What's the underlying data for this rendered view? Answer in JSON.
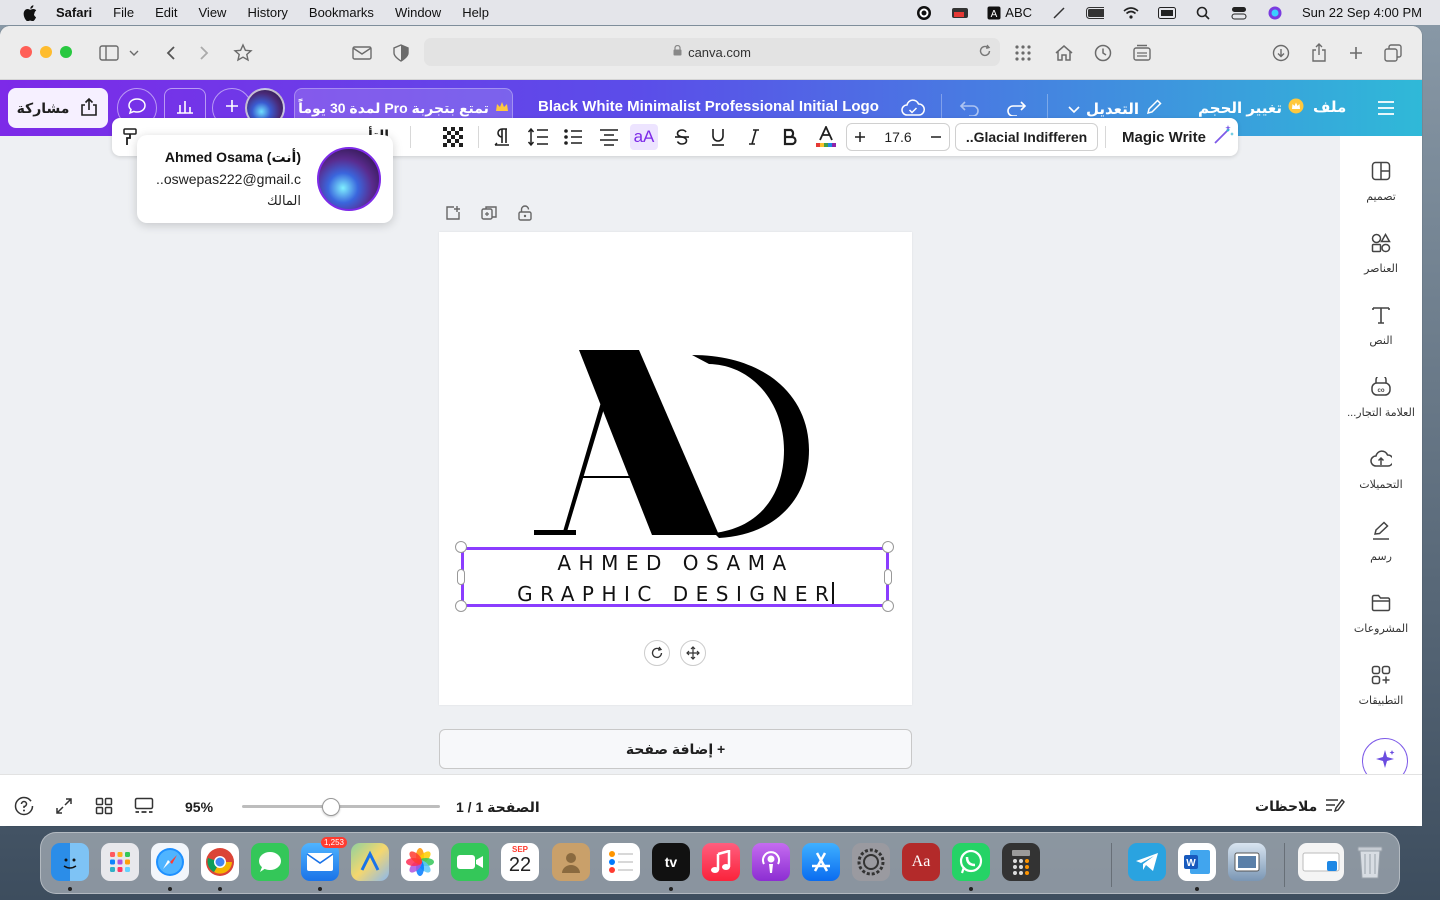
{
  "menubar": {
    "app": "Safari",
    "items": [
      "File",
      "Edit",
      "View",
      "History",
      "Bookmarks",
      "Window",
      "Help"
    ],
    "input_label": "ABC",
    "datetime": "Sun 22 Sep  4:00 PM"
  },
  "browser": {
    "url": "canva.com"
  },
  "canva_header": {
    "share_label": "مشاركة",
    "pro_trial": "تمتع بتجربة Pro لمدة 30 يوماً",
    "doc_title": "Black White Minimalist Professional Initial Logo",
    "edit_label": "التعديل",
    "resize_label": "تغيير الحجم",
    "file_label": "ملف"
  },
  "profile_popup": {
    "name": "Ahmed Osama (أنت)",
    "email": "..oswepas222@gmail.c",
    "role": "المالك"
  },
  "text_toolbar": {
    "partial_label": "التأ",
    "font_name": "..Glacial Indifferen",
    "font_size": "17.6",
    "case_label": "aA",
    "magic_write": "Magic Write"
  },
  "right_panel": {
    "items": [
      {
        "label": "تصميم",
        "icon": "design-icon"
      },
      {
        "label": "العناصر",
        "icon": "elements-icon"
      },
      {
        "label": "النص",
        "icon": "text-icon"
      },
      {
        "label": "العلامة التجار...",
        "icon": "brand-icon"
      },
      {
        "label": "التحميلات",
        "icon": "uploads-icon"
      },
      {
        "label": "رسم",
        "icon": "draw-icon"
      },
      {
        "label": "المشروعات",
        "icon": "projects-icon"
      },
      {
        "label": "التطبيقات",
        "icon": "apps-icon"
      }
    ]
  },
  "canvas": {
    "logo_letters": "AO",
    "line1": "AHMED OSAMA",
    "line2": "GRAPHIC DESIGNER",
    "add_page": "+ إضافة صفحة"
  },
  "statusbar": {
    "zoom": "95%",
    "zoom_level": 0.45,
    "pages": "الصفحة 1 / 1",
    "notes": "ملاحظات"
  },
  "dock": {
    "mail_badge": "1,253",
    "calendar_month": "SEP",
    "calendar_day": "22",
    "dictionary_label": "Aa",
    "tv_label": "tv"
  },
  "colors": {
    "canva_purple": "#7d2ae8",
    "canva_teal": "#2fb9d8",
    "selection": "#8b3dff"
  }
}
